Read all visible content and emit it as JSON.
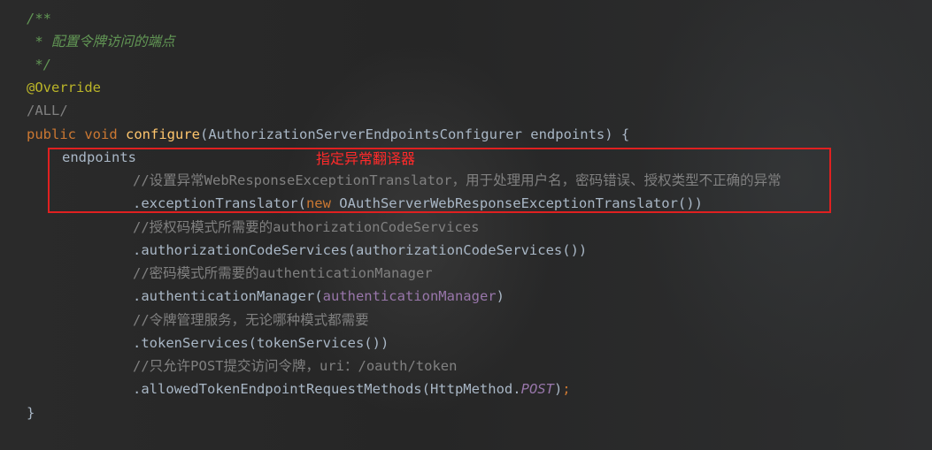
{
  "code": {
    "doc_open": "/**",
    "doc_text": " * 配置令牌访问的端点",
    "doc_close": " */",
    "annotation": "@Override",
    "path_marker": "/ALL/",
    "sig_public": "public ",
    "sig_void": "void ",
    "sig_method": "configure",
    "sig_params": "(AuthorizationServerEndpointsConfigurer endpoints) {",
    "endpoints": "endpoints",
    "comment_translator": "//设置异常WebResponseExceptionTranslator，用于处理用户名，密码错误、授权类型不正确的异常",
    "exc_method": ".exceptionTranslator(",
    "exc_new": "new ",
    "exc_class": "OAuthServerWebResponseExceptionTranslator())",
    "comment_auth_code": "//授权码模式所需要的authorizationCodeServices",
    "auth_code_call": ".authorizationCodeServices(authorizationCodeServices())",
    "comment_auth_manager": "//密码模式所需要的authenticationManager",
    "auth_manager_open": ".authenticationManager(",
    "auth_manager_field": "authenticationManager",
    "auth_manager_close": ")",
    "comment_token": "//令牌管理服务，无论哪种模式都需要",
    "token_call": ".tokenServices(tokenServices())",
    "comment_post": "//只允许POST提交访问令牌，uri：/oauth/token",
    "allowed_call": ".allowedTokenEndpointRequestMethods(HttpMethod.",
    "allowed_post": "POST",
    "allowed_close": ")",
    "allowed_semicolon": ";",
    "close_brace": "}"
  },
  "annotation_box": {
    "label": "指定异常翻译器",
    "color": "#e02020"
  },
  "theme": {
    "background": "#2b2b2b",
    "keyword": "#cc7832",
    "method": "#ffc66d",
    "comment": "#808080",
    "doc": "#629755",
    "annotation": "#bbb529",
    "field": "#9876aa",
    "text": "#a9b7c6"
  }
}
